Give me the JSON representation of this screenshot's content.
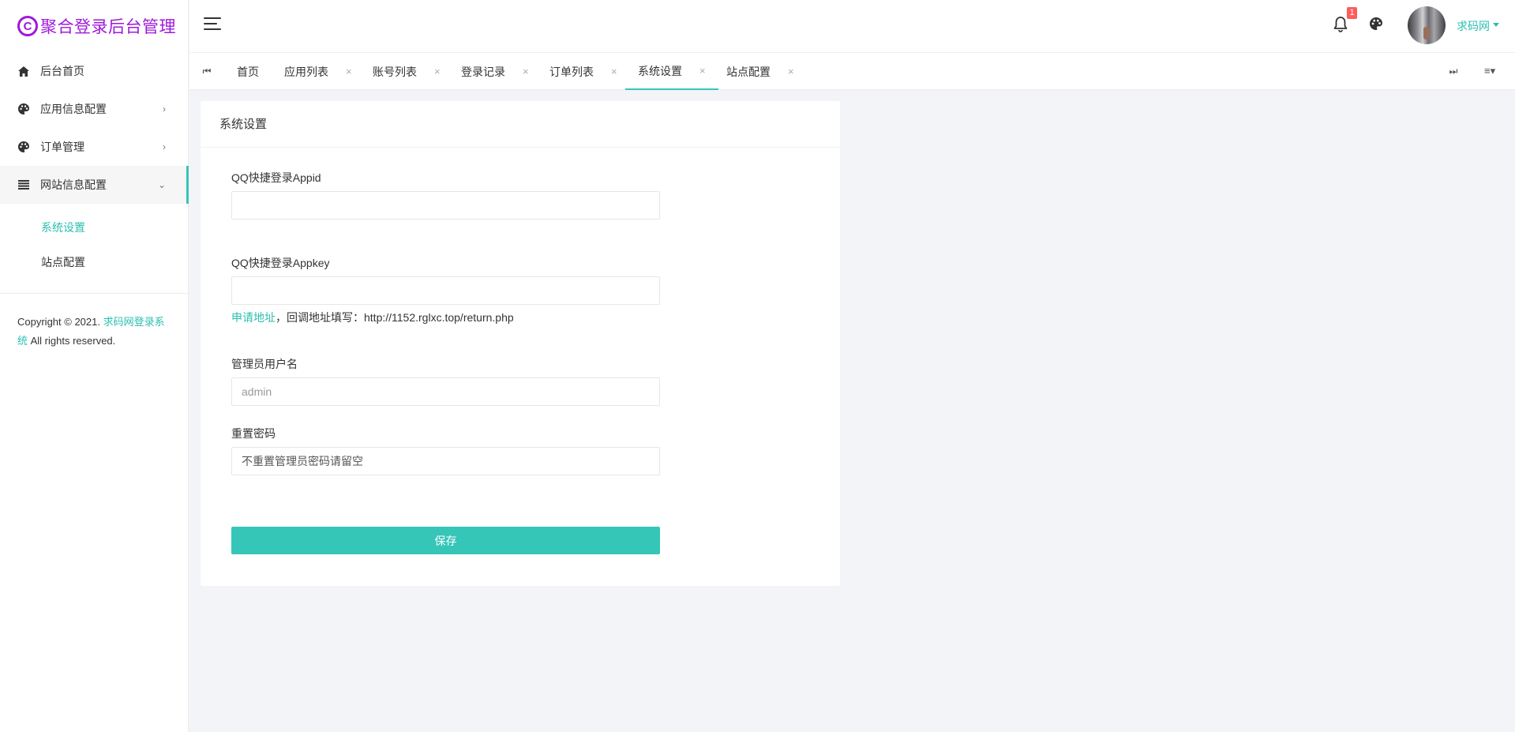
{
  "brand": {
    "logo_letter": "C",
    "title": "聚合登录后台管理",
    "color": "#a01ad8"
  },
  "sidebar": {
    "items": [
      {
        "label": "后台首页",
        "icon": "home-icon"
      },
      {
        "label": "应用信息配置",
        "icon": "palette-icon"
      },
      {
        "label": "订单管理",
        "icon": "palette-icon"
      },
      {
        "label": "网站信息配置",
        "icon": "list-icon"
      }
    ],
    "submenu": [
      {
        "label": "系统设置",
        "active": true
      },
      {
        "label": "站点配置",
        "active": false
      }
    ],
    "copyright": {
      "prefix": "Copyright © 2021. ",
      "link": "求码网登录系统",
      "suffix": " All rights reserved."
    }
  },
  "header": {
    "notification_count": "1",
    "username": "求码网"
  },
  "tabs": {
    "first_icon": "⏮",
    "last_icon": "⏭",
    "menu_icon": "≡▾",
    "close_glyph": "×",
    "items": [
      {
        "label": "首页",
        "closable": false,
        "active": false
      },
      {
        "label": "应用列表",
        "closable": true,
        "active": false
      },
      {
        "label": "账号列表",
        "closable": true,
        "active": false
      },
      {
        "label": "登录记录",
        "closable": true,
        "active": false
      },
      {
        "label": "订单列表",
        "closable": true,
        "active": false
      },
      {
        "label": "系统设置",
        "closable": true,
        "active": true
      },
      {
        "label": "站点配置",
        "closable": true,
        "active": false
      }
    ]
  },
  "form": {
    "title": "系统设置",
    "fields": [
      {
        "label": "QQ快捷登录Appid",
        "value": "",
        "placeholder": ""
      },
      {
        "label": "QQ快捷登录Appkey",
        "value": "",
        "placeholder": ""
      },
      {
        "label": "管理员用户名",
        "value": "",
        "placeholder": "admin"
      },
      {
        "label": "重置密码",
        "value": "",
        "placeholder": "不重置管理员密码请留空"
      }
    ],
    "help": {
      "link": "申请地址",
      "text": "，回调地址填写：http://1152.rglxc.top/return.php"
    },
    "save_label": "保存"
  },
  "colors": {
    "accent": "#36c6b8",
    "link": "#2bbfb0",
    "badge": "#ff5b5b",
    "background": "#f3f4f8"
  }
}
